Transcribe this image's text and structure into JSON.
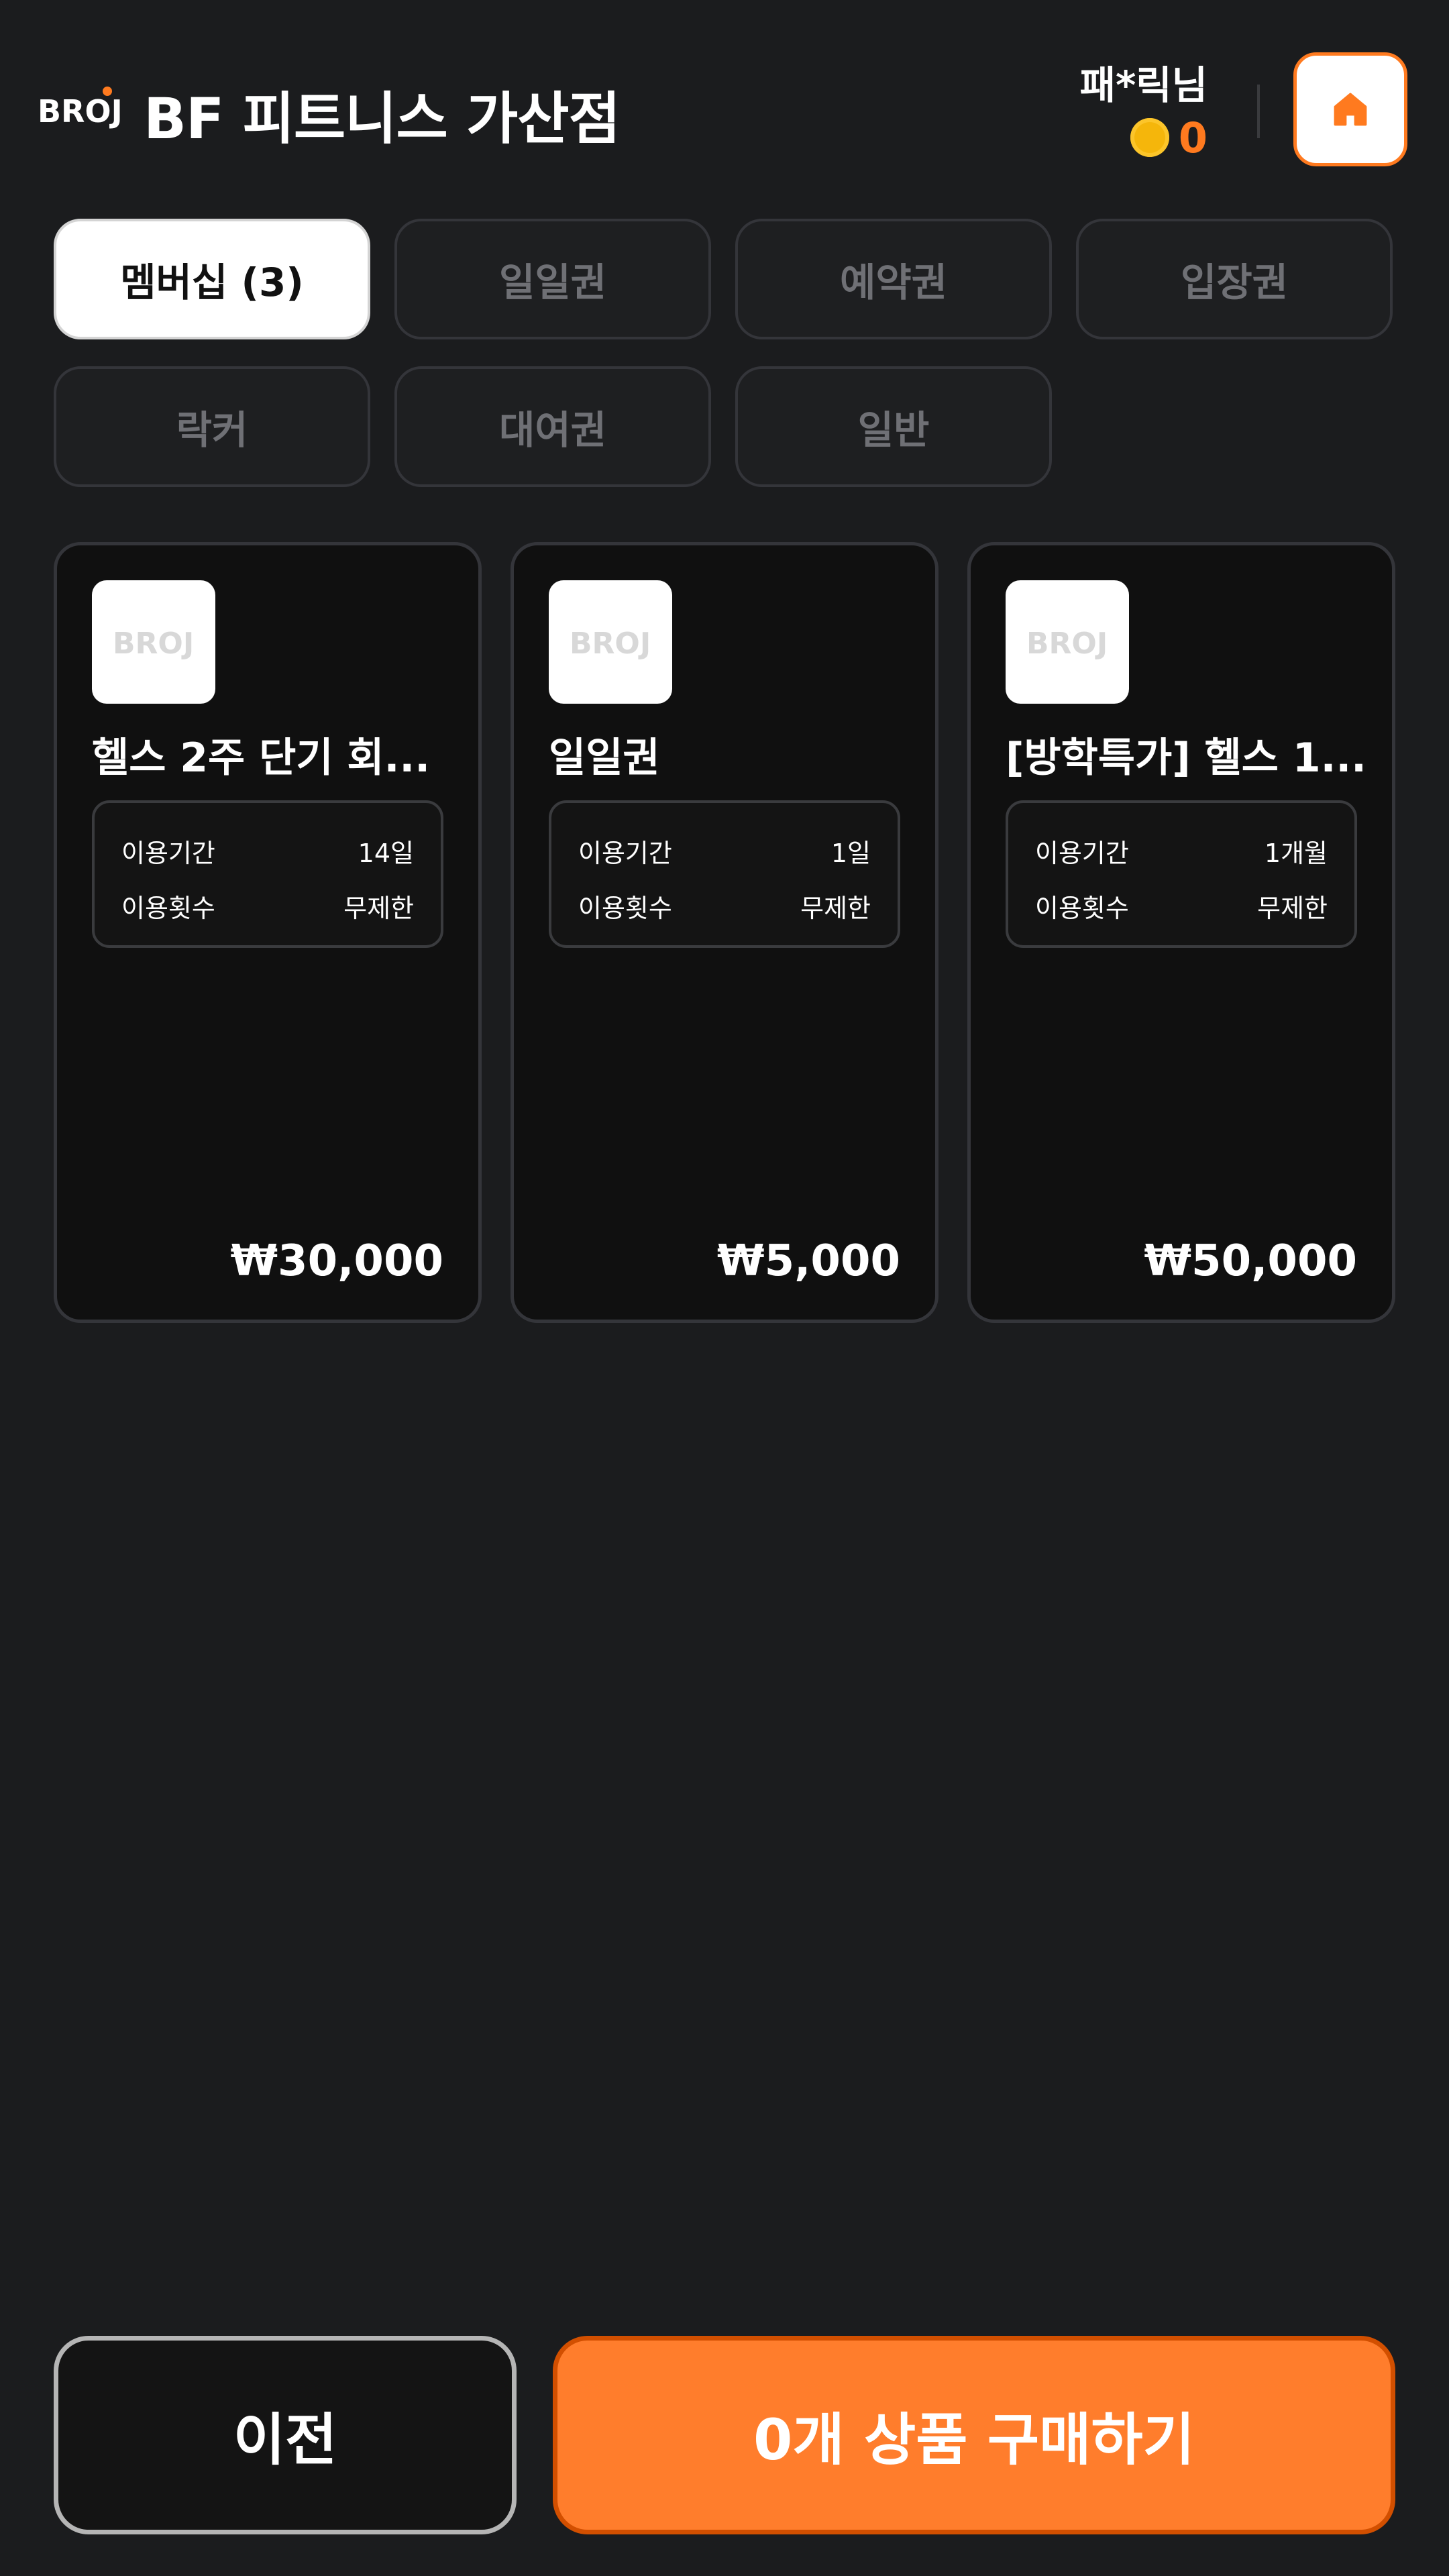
{
  "header": {
    "logo_text": "BROJ",
    "store_name": "BF 피트니스 가산점",
    "user_name": "패*릭님",
    "points": "0",
    "home_icon": "home-icon",
    "coin_icon": "coin-icon"
  },
  "tabs": [
    {
      "label": "멤버십 (3)",
      "active": true
    },
    {
      "label": "일일권",
      "active": false
    },
    {
      "label": "예약권",
      "active": false
    },
    {
      "label": "입장권",
      "active": false
    },
    {
      "label": "락커",
      "active": false
    },
    {
      "label": "대여권",
      "active": false
    },
    {
      "label": "일반",
      "active": false
    }
  ],
  "products": [
    {
      "thumb_text": "BROJ",
      "title": "헬스 2주 단기 회...",
      "period_label": "이용기간",
      "period_value": "14일",
      "count_label": "이용횟수",
      "count_value": "무제한",
      "price": "₩30,000"
    },
    {
      "thumb_text": "BROJ",
      "title": "일일권",
      "period_label": "이용기간",
      "period_value": "1일",
      "count_label": "이용횟수",
      "count_value": "무제한",
      "price": "₩5,000"
    },
    {
      "thumb_text": "BROJ",
      "title": "[방학특가] 헬스 1...",
      "period_label": "이용기간",
      "period_value": "1개월",
      "count_label": "이용횟수",
      "count_value": "무제한",
      "price": "₩50,000"
    }
  ],
  "footer": {
    "prev_label": "이전",
    "buy_label": "0개 상품 구매하기"
  },
  "colors": {
    "background": "#1b1c1e",
    "accent": "#ff7d2c",
    "points": "#ff7a1f",
    "coin": "#f5b60b"
  }
}
